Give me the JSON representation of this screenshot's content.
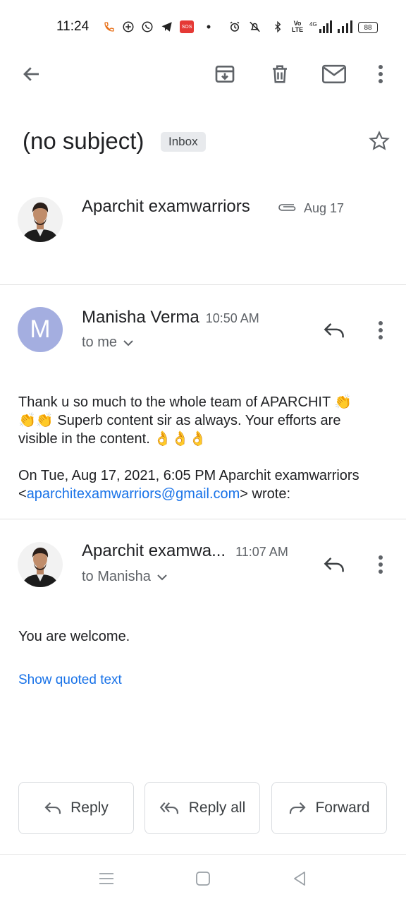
{
  "status_bar": {
    "time": "11:24",
    "battery": "88",
    "network": "4G",
    "sos": "SOS"
  },
  "toolbar": {
    "icons": [
      "back-arrow-icon",
      "archive-icon",
      "delete-icon",
      "mark-unread-icon",
      "more-vert-icon"
    ]
  },
  "subject": {
    "title": "(no subject)",
    "label": "Inbox"
  },
  "thread_header": {
    "sender": "Aparchit examwarriors",
    "date": "Aug 17"
  },
  "message1": {
    "avatar_letter": "M",
    "avatar_color": "#a4aee0",
    "sender": "Manisha Verma",
    "time": "10:50 AM",
    "recipient": "to me",
    "body_line1": "Thank u so much to the whole team of APARCHIT 👏",
    "body_line2": "👏👏 Superb content sir as always. Your efforts are",
    "body_line3": "visible in the content. 👌👌👌",
    "quote_line1": "On Tue, Aug 17, 2021, 6:05 PM Aparchit examwarriors",
    "quote_lt": "<",
    "quote_email": "aparchitexamwarriors@gmail.com",
    "quote_end": "> wrote:"
  },
  "message2": {
    "sender": "Aparchit examwa...",
    "time": "11:07 AM",
    "recipient": "to Manisha",
    "body": "You are welcome.",
    "show_quoted": "Show quoted text"
  },
  "actions": {
    "reply": "Reply",
    "reply_all": "Reply all",
    "forward": "Forward"
  },
  "colors": {
    "link": "#1a73e8",
    "chip_bg": "#e8eaed",
    "icon": "#5f6368"
  }
}
